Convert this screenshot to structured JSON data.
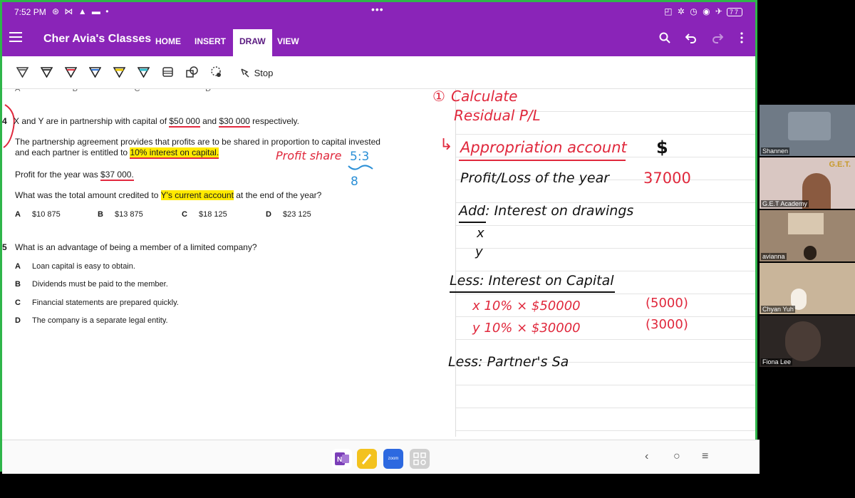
{
  "status": {
    "time": "7:52 PM",
    "icons_left": "⊛ ⋈ ▲ ▬ •",
    "dots": "•••",
    "icons_right": "◰ ✲ ◷ ◉ ✈",
    "battery": "77"
  },
  "app": {
    "title": "Cher Avia's Classes",
    "tabs": [
      "HOME",
      "INSERT",
      "DRAW",
      "VIEW"
    ],
    "active_tab": "DRAW",
    "accent": "#8a24b8"
  },
  "toolbar": {
    "stop_label": "Stop",
    "pen_colors": [
      "#6a6a6a",
      "#3b3b3b",
      "#e02a3c",
      "#2a6fd0",
      "#e8c400",
      "#2ab9c9"
    ]
  },
  "question4": {
    "number": "4",
    "line1_pre": "X and Y are in partnership with capital of ",
    "cap_x": "$50 000",
    "line1_mid": " and ",
    "cap_y": "$30 000",
    "line1_post": " respectively.",
    "line2": "The partnership agreement provides that profits are to be shared in proportion to capital invested",
    "line3_pre": "and each partner is entitled to ",
    "line3_hl": "10% interest on capital.",
    "profit_pre": "Profit for the year was ",
    "profit_val": "$37 000.",
    "ask_pre": "What was the total amount credited to ",
    "ask_hl": "Y's current account",
    "ask_post": " at the end of the year?",
    "options": [
      {
        "letter": "A",
        "text": "$10 875"
      },
      {
        "letter": "B",
        "text": "$13 875"
      },
      {
        "letter": "C",
        "text": "$18 125"
      },
      {
        "letter": "D",
        "text": "$23 125"
      }
    ]
  },
  "question5": {
    "number": "5",
    "text": "What is an advantage of being a member of a limited company?",
    "options": [
      {
        "letter": "A",
        "text": "Loan capital is easy to obtain."
      },
      {
        "letter": "B",
        "text": "Dividends must be paid to the member."
      },
      {
        "letter": "C",
        "text": "Financial statements are prepared quickly."
      },
      {
        "letter": "D",
        "text": "The company is a separate legal entity."
      }
    ]
  },
  "ink": {
    "profit_share": "Profit share",
    "ratio": "5:3",
    "ratio_total": "8",
    "step1": "Calculate",
    "step1b": "Residual P/L",
    "approp": "Appropriation account",
    "dollar": "$",
    "profit_line": "Profit/Loss of the year",
    "profit_amt": "37000",
    "add_line": "Add: Interest on drawings",
    "x": "x",
    "y": "y",
    "less_interest": "Less: Interest on Capital",
    "x_calc": "x   10% × $50000",
    "y_calc": "y   10% × $30000",
    "x_amt": "(5000)",
    "y_amt": "(3000)",
    "less_salary": "Less: Partner's Sa"
  },
  "participants": [
    {
      "name": "Shannen",
      "bg": "#6f7a86"
    },
    {
      "name": "G.E.T Academy",
      "bg": "#d9c7c2",
      "logo": "G.E.T."
    },
    {
      "name": "avianna",
      "bg": "#9c8670"
    },
    {
      "name": "Chyan Yuh",
      "bg": "#c9b59a"
    },
    {
      "name": "Fiona Lee",
      "bg": "#2c2624"
    }
  ],
  "dock": [
    {
      "name": "onenote",
      "color": "#7b3fb8"
    },
    {
      "name": "notes",
      "color": "#f3c21e"
    },
    {
      "name": "zoom",
      "color": "#2d69e0",
      "label": "zoom"
    },
    {
      "name": "apps",
      "color": "#cfcfcf"
    }
  ]
}
